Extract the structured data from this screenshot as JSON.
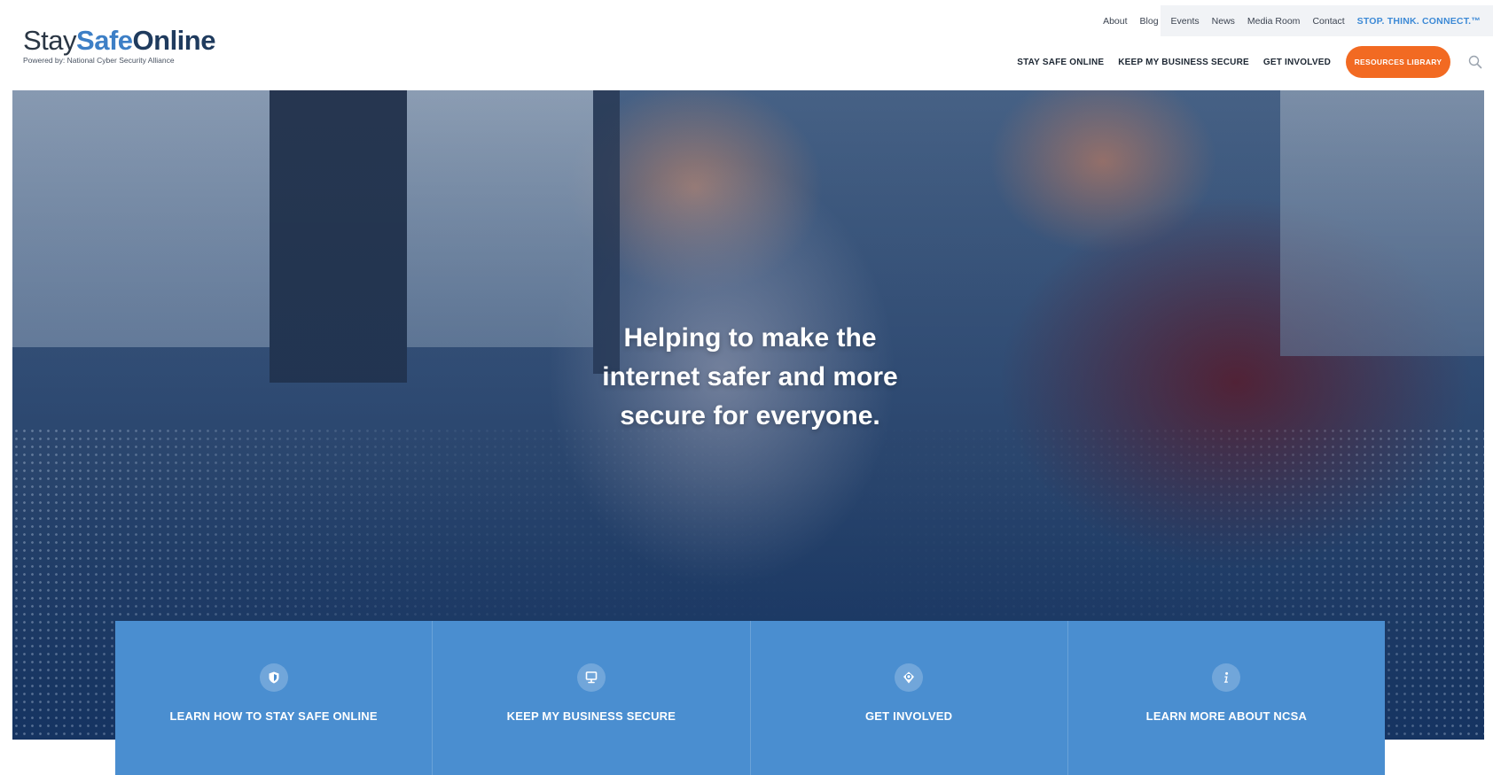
{
  "logo": {
    "word_stay": "Stay",
    "word_safe": "Safe",
    "word_online": "Online",
    "tagline": "Powered by: National Cyber Security Alliance"
  },
  "utility_nav": {
    "items": [
      "About",
      "Blog",
      "Events",
      "News",
      "Media Room",
      "Contact"
    ],
    "stop_think_connect": "STOP. THINK. CONNECT.™"
  },
  "main_nav": {
    "items": [
      "STAY SAFE ONLINE",
      "KEEP MY BUSINESS SECURE",
      "GET INVOLVED"
    ],
    "resources_button": "RESOURCES LIBRARY",
    "search_icon": "search-icon"
  },
  "hero": {
    "headline_lines": [
      "Helping to make the",
      "internet safer and more",
      "secure for everyone."
    ]
  },
  "cards": [
    {
      "label": "LEARN HOW TO STAY SAFE ONLINE",
      "icon": "shield-icon"
    },
    {
      "label": "KEEP MY BUSINESS SECURE",
      "icon": "monitor-icon"
    },
    {
      "label": "GET INVOLVED",
      "icon": "badge-icon"
    },
    {
      "label": "LEARN MORE ABOUT NCSA",
      "icon": "info-icon"
    }
  ],
  "colors": {
    "brand_blue": "#3d7fc6",
    "accent_orange": "#f26a22",
    "card_blue": "#4a8ed0",
    "utility_bar": "#f1f3f6"
  }
}
